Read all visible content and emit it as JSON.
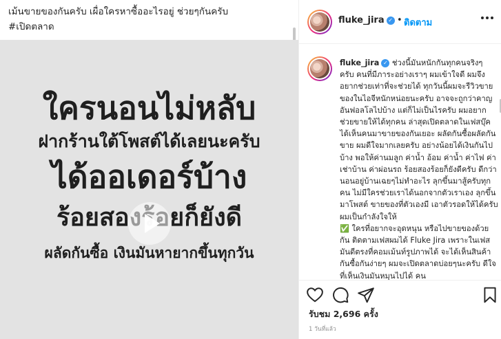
{
  "post": {
    "caption_line1": "เม้นขายของกันครับ เผื่อใครหาซื้ออะไรอยู่ ช่วยๆกันครับ",
    "caption_line2": "#เปิดตลาด",
    "media_text": [
      "ใครนอนไม่หลับ",
      "ฝากร้านใต้โพสต์ได้เลยนะครับ",
      "ได้ออเดอร์บ้าง",
      "ร้อยสองร้อยก็ยังดี",
      "ผลัดกันซื้อ เงินมันหายากขึ้นทุกวัน"
    ],
    "video_play_icon": "play-icon"
  },
  "header": {
    "username": "fluke_jira",
    "verified_icon": "verified-badge-icon",
    "separator": "•",
    "follow_label": "ติดตาม",
    "more_icon": "more-options-icon"
  },
  "comment": {
    "username": "fluke_jira",
    "text": "ช่วงนี้มันหนักกันทุกคนจริงๆ ครับ คนที่มีภาระอย่างเราๆ ผมเข้าใจดี ผมจึงอยากช่วยเท่าที่จะช่วยได้ ทุกวันนี้ผมจะรีวิวขายของในไอจีหนักหน่อยนะครับ อาจจะถูกว่าคาญอันฟอลโลไปบ้าง แต่ก็ไม่เป็นไรครับ ผมอยากช่วยขายให้ได้ทุกคน ล่าสุดเปิดตลาดในเฟสบุ๊ค ได้เห็นคนมาขายของกันเยอะ ผลัดกันซื้อผลัดกันขาย ผมดีใจมากเลยครับ อย่างน้อยได้เงินกันไปบ้าง พอให้ค่านมลูก ค่าน้ำ อ้อม ค่าน้ำ ค่าไฟ ค่าเช่าบ้าน ค่าผ่อนรถ ร้อยสองร้อยก็ยังดีครับ ดีกว่านอนอยู่บ้านเฉยๆไม่ทำอะไร ลุกขึ้นมาสู้ครับทุกคน ไม่มีใครช่วยเราได้นอกจากตัวเราเอง ลุกขึ้นมาโพสต์ ขายของที่ตัวเองมี เอาตัวรอดให้ได้ครับ ผมเป็นกำลังใจให้",
    "check_emoji": "✅",
    "text2": "ใครที่อยากจะอุดหนุน หรือไปขายของด้วยกัน ติดตามเฟสผมได้ Fluke Jira เพราะในเฟสมันดีตรงที่คอมเม้นท์รูปภาพได้ จะได้เห็นสินค้ากันซื้อกันง่ายๆ ผมจะเปิดตลาดบ่อยๆนะครับ ดีใจที่เห็นเงินมันหมุนไปได้ คน"
  },
  "actions": {
    "icons": [
      "heart-icon",
      "comment-icon",
      "share-icon",
      "bookmark-icon"
    ],
    "likes_label": "รับชม 2,696 ครั้ง",
    "time_ago": "1 วันที่แล้ว"
  }
}
